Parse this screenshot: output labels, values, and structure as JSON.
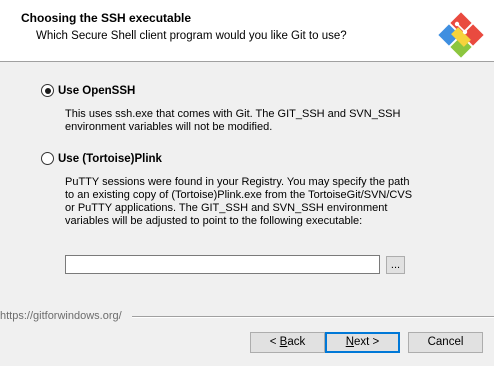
{
  "header": {
    "title": "Choosing the SSH executable",
    "subtitle": "Which Secure Shell client program would you like Git to use?",
    "logo_icon": "git-logo-icon"
  },
  "options": [
    {
      "label": "Use OpenSSH",
      "selected": true,
      "description": [
        "This uses ssh.exe that comes with Git. The GIT_SSH and SVN_SSH",
        "environment variables will not be modified."
      ]
    },
    {
      "label": "Use (Tortoise)Plink",
      "selected": false,
      "description": [
        "PuTTY sessions were found in your Registry. You may specify the path",
        "to an existing copy of (Tortoise)Plink.exe from the TortoiseGit/SVN/CVS",
        "or PuTTY applications. The GIT_SSH and SVN_SSH environment",
        "variables will be adjusted to point to the following executable:"
      ]
    }
  ],
  "plink_path": {
    "value": "",
    "browse_label": "..."
  },
  "footer": {
    "url": "https://gitforwindows.org/"
  },
  "buttons": {
    "back_prefix": "< ",
    "back_accel": "B",
    "back_rest": "ack",
    "next_prefix": "",
    "next_accel": "N",
    "next_rest": "ext >",
    "cancel": "Cancel"
  },
  "colors": {
    "header_bg": "#ffffff",
    "dialog_bg": "#f0f0f0",
    "default_button_border": "#0078d7",
    "logo_red": "#e94a3f",
    "logo_green": "#8cc63f",
    "logo_blue": "#3f8fe0",
    "logo_yellow": "#f6d33c"
  }
}
